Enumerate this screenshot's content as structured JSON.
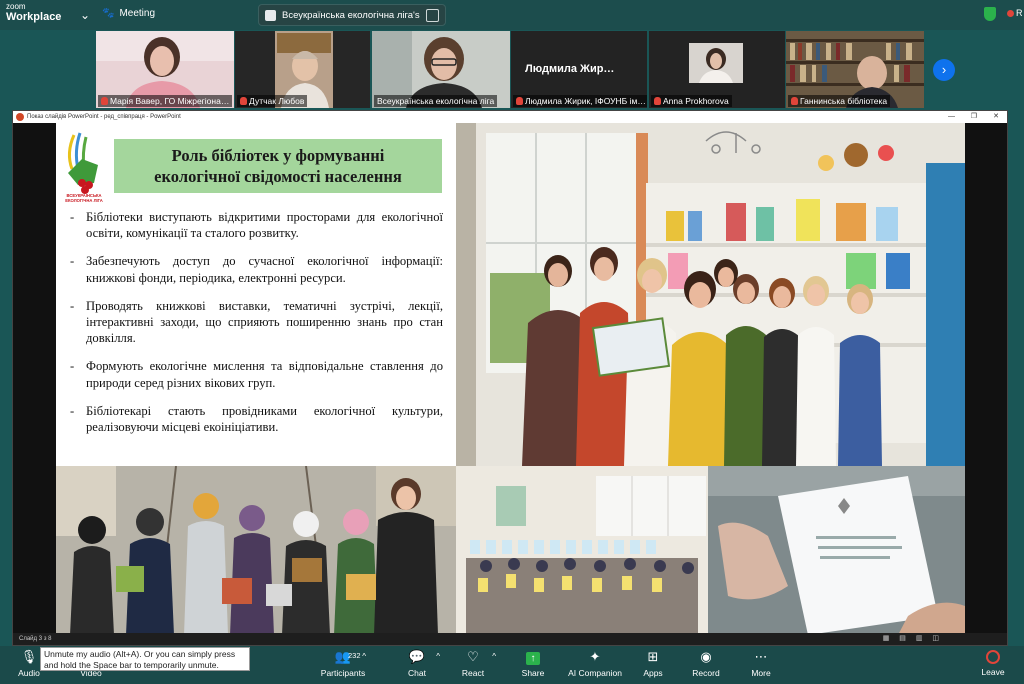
{
  "app": {
    "logo_line1": "zoom",
    "logo_line2": "Workplace",
    "meeting_label": "Meeting"
  },
  "chip": {
    "label": "Всеукраїнська екологічна ліга's"
  },
  "participants": [
    {
      "name": "Марія Вавер, ГО Міжрегіона…",
      "muted": true
    },
    {
      "name": "Дутчак Любов",
      "muted": true
    },
    {
      "name": "Всеукраїнська екологічна ліга",
      "muted": false,
      "active": true
    },
    {
      "name": "Людмила Жирик, ІФОУНБ ім…",
      "muted": true,
      "big_label": "Людмила  Жир…"
    },
    {
      "name": "Anna Prokhorova",
      "muted": true
    },
    {
      "name": "Ганнинська бібліотека",
      "muted": true
    }
  ],
  "ppt": {
    "window_title": "Показ слайдів PowerPoint - ред_співпраця - PowerPoint",
    "status_left": "Слайд 3 з 8",
    "slide": {
      "logo_text": "ВСЕУКРАЇНСЬКА ЕКОЛОГІЧНА ЛІГА",
      "title_line1": "Роль бібліотек у формуванні",
      "title_line2": "екологічної свідомості населення",
      "bullets": [
        "Бібліотеки виступають відкритими просторами для екологічної освіти, комунікації та сталого розвитку.",
        "Забезпечують доступ до сучасної екологічної інформації: книжкові фонди, періодика, електронні ресурси.",
        "Проводять книжкові виставки, тематичні зустрічі, лекції, інтерактивні заходи, що сприяють поширенню знань про стан довкілля.",
        "Формують екологічне мислення та відповідальне ставлення до природи серед різних вікових груп.",
        "Бібліотекарі стають провідниками екологічної культури, реалізовуючи місцеві екоініціативи."
      ],
      "photos": [
        "library-group-photo",
        "children-birdhouses-photo",
        "hall-eco-letters-photo",
        "brochure-hand-photo"
      ]
    }
  },
  "tooltip": {
    "text": "Unmute my audio (Alt+A). Or you can simply press and hold the Space bar to temporarily unmute."
  },
  "controls": [
    {
      "key": "audio",
      "label": "Audio",
      "icon": "mic-icon"
    },
    {
      "key": "video",
      "label": "Video",
      "icon": "camera-icon"
    },
    {
      "key": "participants",
      "label": "Participants",
      "icon": "participants-icon",
      "count": "232"
    },
    {
      "key": "chat",
      "label": "Chat",
      "icon": "chat-icon"
    },
    {
      "key": "react",
      "label": "React",
      "icon": "heart-icon"
    },
    {
      "key": "share",
      "label": "Share",
      "icon": "share-icon"
    },
    {
      "key": "ai",
      "label": "AI Companion",
      "icon": "sparkle-icon"
    },
    {
      "key": "apps",
      "label": "Apps",
      "icon": "apps-icon"
    },
    {
      "key": "record",
      "label": "Record",
      "icon": "record-icon"
    },
    {
      "key": "more",
      "label": "More",
      "icon": "more-icon"
    },
    {
      "key": "leave",
      "label": "Leave",
      "icon": "leave-icon"
    }
  ],
  "colors": {
    "zoom_bg": "#1b5656",
    "title_box": "#a4d69c",
    "active_tile": "#2bb24c",
    "muted_red": "#e0453a"
  }
}
